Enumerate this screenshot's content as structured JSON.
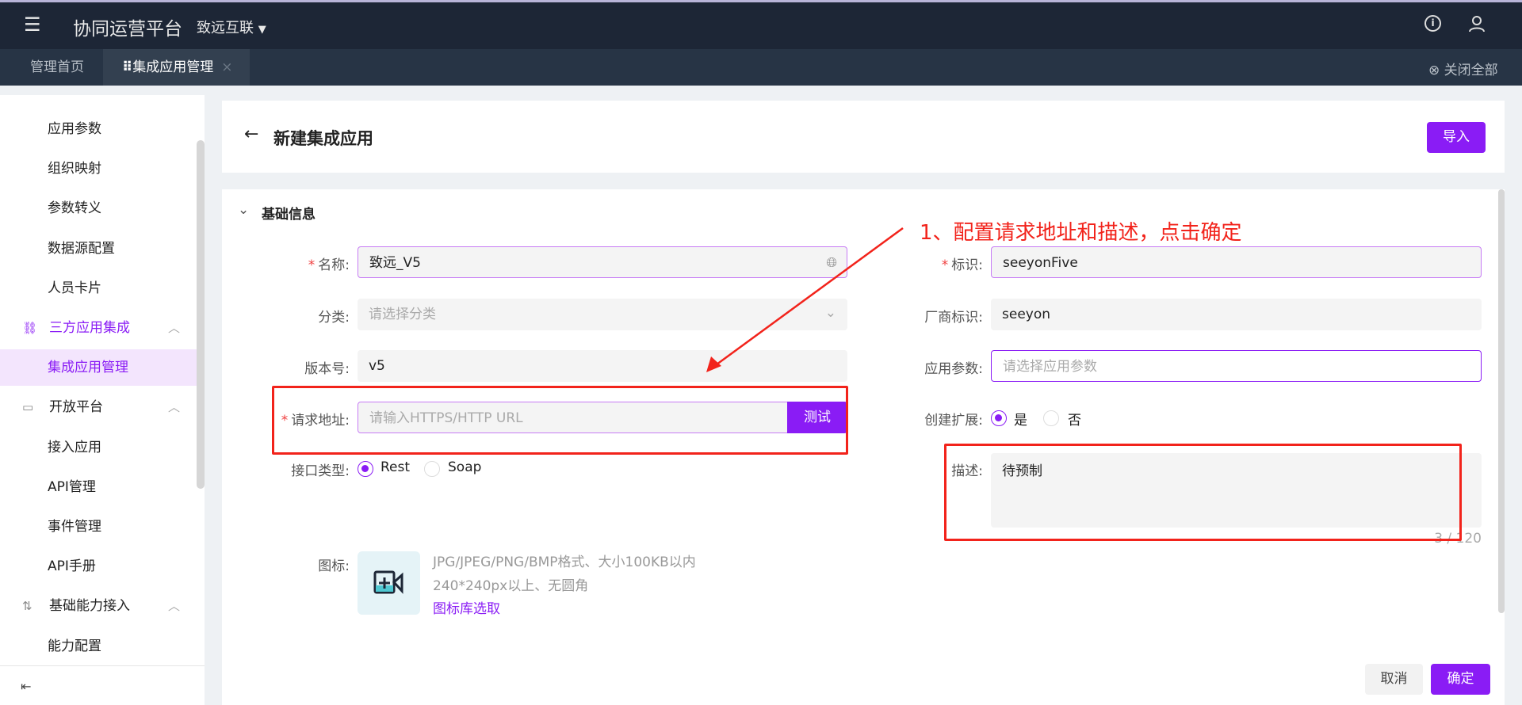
{
  "header": {
    "app_title": "协同运营平台",
    "org": "致远互联"
  },
  "tabs": [
    {
      "label": "管理首页"
    },
    {
      "label": "集成应用管理",
      "active": true
    }
  ],
  "close_all": "关闭全部",
  "sidebar": {
    "items": [
      {
        "label": "应用参数"
      },
      {
        "label": "组织映射"
      },
      {
        "label": "参数转义"
      },
      {
        "label": "数据源配置"
      },
      {
        "label": "人员卡片"
      },
      {
        "label": "三方应用集成",
        "group": true,
        "icon": "flow-icon"
      },
      {
        "label": "集成应用管理",
        "active": true
      },
      {
        "label": "开放平台",
        "group": true,
        "icon": "monitor-icon"
      },
      {
        "label": "接入应用"
      },
      {
        "label": "API管理"
      },
      {
        "label": "事件管理"
      },
      {
        "label": "API手册"
      },
      {
        "label": "基础能力接入",
        "group": true,
        "icon": "slider-icon"
      },
      {
        "label": "能力配置"
      }
    ]
  },
  "page": {
    "title": "新建集成应用",
    "import_label": "导入",
    "section_title": "基础信息"
  },
  "form": {
    "name": {
      "label": "名称:",
      "value": "致远_V5"
    },
    "category": {
      "label": "分类:",
      "placeholder": "请选择分类"
    },
    "version": {
      "label": "版本号:",
      "value": "v5"
    },
    "url": {
      "label": "请求地址:",
      "placeholder": "请输入HTTPS/HTTP URL",
      "test_label": "测试"
    },
    "interface_type": {
      "label": "接口类型:",
      "options": [
        "Rest",
        "Soap"
      ],
      "selected": "Rest"
    },
    "icon": {
      "label": "图标:",
      "hint1": "JPG/JPEG/PNG/BMP格式、大小100KB以内",
      "hint2": "240*240px以上、无圆角",
      "library_link": "图标库选取"
    },
    "identifier": {
      "label": "标识:",
      "value": "seeyonFive"
    },
    "vendor": {
      "label": "厂商标识:",
      "value": "seeyon"
    },
    "app_params": {
      "label": "应用参数:",
      "placeholder": "请选择应用参数"
    },
    "create_ext": {
      "label": "创建扩展:",
      "options": [
        "是",
        "否"
      ],
      "selected": "是"
    },
    "description": {
      "label": "描述:",
      "value": "待预制",
      "counter": "3 / 120"
    }
  },
  "footer": {
    "cancel": "取消",
    "confirm": "确定"
  },
  "annotation": {
    "text": "1、配置请求地址和描述，点击确定",
    "color": "#f2231b"
  },
  "colors": {
    "accent": "#8a1cf5",
    "topbar": "#1d2636",
    "tabbar": "#273445"
  }
}
